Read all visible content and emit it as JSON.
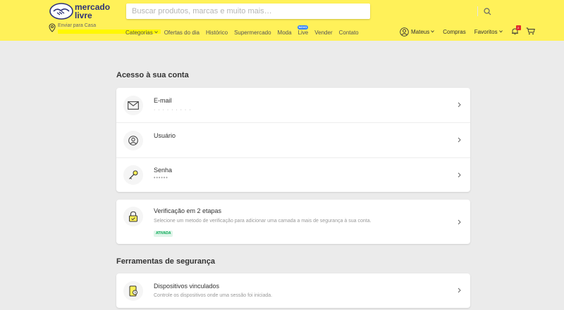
{
  "header": {
    "logo_text_line1": "mercado",
    "logo_text_line2": "livre",
    "search_placeholder": "Buscar produtos, marcas e muito mais…",
    "location_label": "Enviar para Casa",
    "nav_items": [
      {
        "label": "Categorias",
        "has_caret": true
      },
      {
        "label": "Ofertas do dia"
      },
      {
        "label": "Histórico"
      },
      {
        "label": "Supermercado"
      },
      {
        "label": "Moda"
      },
      {
        "label": "Live",
        "badge": "NOVO"
      },
      {
        "label": "Vender"
      },
      {
        "label": "Contato"
      }
    ],
    "user_name": "Mateus",
    "compras_label": "Compras",
    "favoritos_label": "Favoritos",
    "notification_count": "2",
    "icons": {
      "search": "search-icon",
      "location": "location-pin-icon",
      "user": "user-avatar-icon",
      "bell": "bell-icon",
      "cart": "cart-icon"
    }
  },
  "account_section": {
    "title": "Acesso à sua conta",
    "rows": [
      {
        "icon": "mail-icon",
        "title": "E-mail",
        "sub": "· · · · · · · · ·"
      },
      {
        "icon": "user-icon",
        "title": "Usuário",
        "sub": ""
      },
      {
        "icon": "key-icon",
        "title": "Senha",
        "sub": "••••••"
      }
    ]
  },
  "two_factor": {
    "icon": "lock-icon",
    "title": "Verificação em 2 etapas",
    "sub": "Selecione um metodo de verificação para adicionar uma camada a mais de segurança à sua conta.",
    "status": "ATIVADA"
  },
  "security_section": {
    "title": "Ferramentas de segurança",
    "rows": [
      {
        "icon": "device-icon",
        "title": "Dispositivos vinculados",
        "sub": "Controle os dispositivos onde uma sessão foi iniciada."
      }
    ]
  },
  "colors": {
    "header_bg": "#fff159",
    "brand_blue": "#2d3277",
    "page_bg": "#ebebeb",
    "status_green": "#00a650"
  }
}
